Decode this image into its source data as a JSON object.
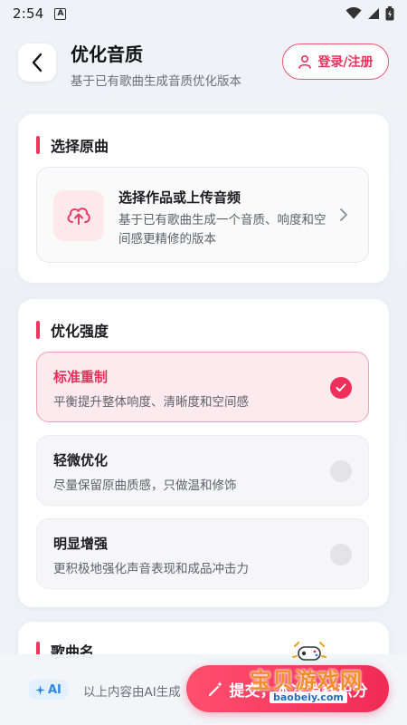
{
  "status_bar": {
    "time": "2:54",
    "notification": "A"
  },
  "header": {
    "title": "优化音质",
    "subtitle": "基于已有歌曲生成音质优化版本",
    "login_label": "登录/注册"
  },
  "select_song": {
    "section_title": "选择原曲",
    "upload_title": "选择作品或上传音频",
    "upload_desc": "基于已有歌曲生成一个音质、响度和空间感更精修的版本"
  },
  "intensity": {
    "section_title": "优化强度",
    "options": [
      {
        "title": "标准重制",
        "desc": "平衡提升整体响度、清晰度和空间感",
        "selected": true
      },
      {
        "title": "轻微优化",
        "desc": "尽量保留原曲质感，只做温和修饰",
        "selected": false
      },
      {
        "title": "明显增强",
        "desc": "更积极地强化声音表现和成品冲击力",
        "selected": false
      }
    ]
  },
  "song_name": {
    "section_title": "歌曲名"
  },
  "bottom_bar": {
    "ai_badge": "AI",
    "ai_note": "以上内容由AI生成",
    "submit_label": "提交，本次消耗积分"
  },
  "watermark": {
    "text": "宝贝游戏网",
    "url": "baobeiy.com"
  },
  "colors": {
    "accent": "#f0365e",
    "accent_light": "#fde8ec",
    "ai_blue": "#2f86e0"
  }
}
